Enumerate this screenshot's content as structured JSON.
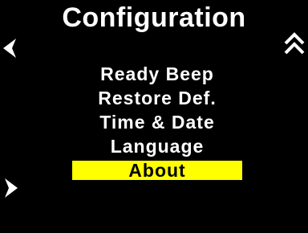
{
  "screen": {
    "title": "Configuration",
    "background_color": "#000000",
    "text_color": "#ffffff",
    "highlight_color": "#ffff00",
    "highlight_text_color": "#000000"
  },
  "navigation": {
    "left_icon": "chevron-left-icon",
    "right_icon": "chevron-right-icon",
    "up_icon": "double-chevron-up-icon"
  },
  "menu": {
    "items": [
      {
        "label": "Ready Beep",
        "selected": false
      },
      {
        "label": "Restore Def.",
        "selected": false
      },
      {
        "label": "Time & Date",
        "selected": false
      },
      {
        "label": "Language",
        "selected": false
      },
      {
        "label": "About",
        "selected": true
      }
    ]
  }
}
